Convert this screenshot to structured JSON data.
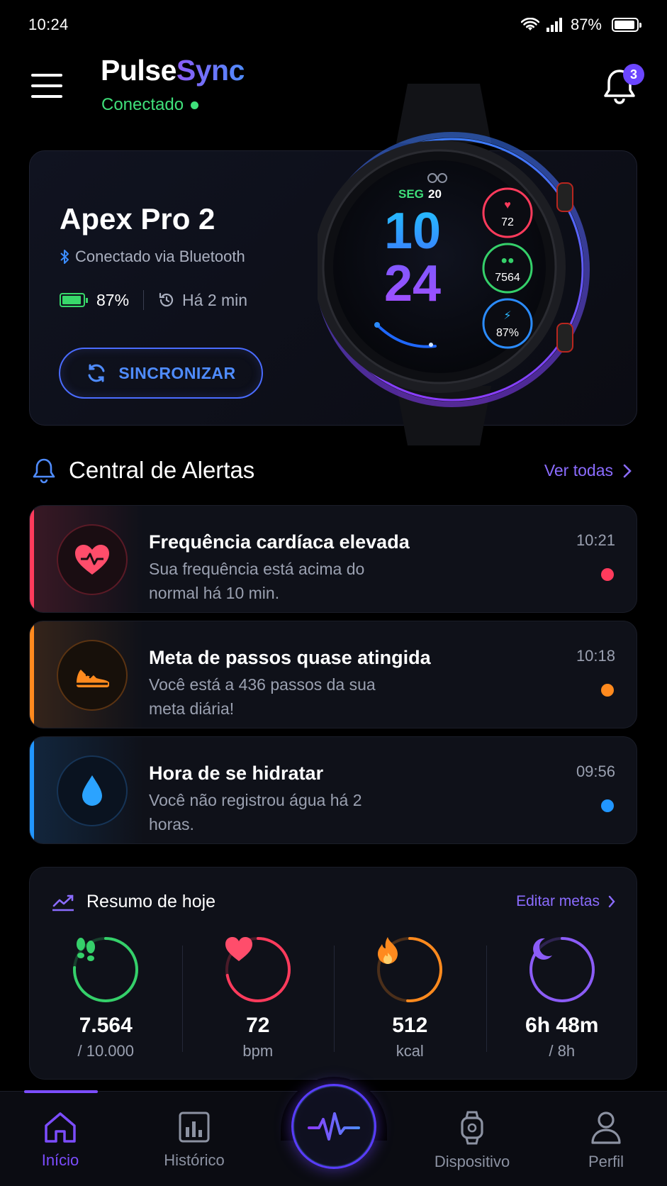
{
  "status_bar": {
    "time": "10:24",
    "battery": "87%"
  },
  "header": {
    "brand_part1": "Pulse",
    "brand_part2": "Sync",
    "connection_status": "Conectado",
    "notification_count": "3"
  },
  "device": {
    "name": "Apex Pro 2",
    "connection": "Conectado via Bluetooth",
    "battery": "87%",
    "last_sync": "Há 2 min",
    "sync_button": "SINCRONIZAR",
    "watch_face": {
      "day": "SEG",
      "date": "20",
      "hour": "10",
      "minute": "24",
      "heart_rate": "72",
      "steps": "7564",
      "battery": "87%",
      "progress": 0.55
    }
  },
  "alerts": {
    "title": "Central de Alertas",
    "see_all": "Ver todas",
    "items": [
      {
        "title": "Frequência cardíaca elevada",
        "desc": "Sua frequência está acima do normal há 10 min.",
        "time": "10:21",
        "color": "#ff3b5c",
        "icon": "heart-pulse-icon"
      },
      {
        "title": "Meta de passos quase atingida",
        "desc": "Você está a 436 passos da sua meta diária!",
        "time": "10:18",
        "color": "#ff8a1e",
        "icon": "sneaker-icon"
      },
      {
        "title": "Hora de se hidratar",
        "desc": "Você não registrou água há 2 horas.",
        "time": "09:56",
        "color": "#2196ff",
        "icon": "water-drop-icon"
      }
    ]
  },
  "summary": {
    "title": "Resumo de hoje",
    "edit_goals": "Editar metas",
    "metrics": [
      {
        "value": "7.564",
        "sub": "/ 10.000",
        "color": "#35d06a",
        "progress": 0.76,
        "icon": "footsteps-icon"
      },
      {
        "value": "72",
        "sub": "bpm",
        "color": "#ff3b5c",
        "progress": 0.72,
        "icon": "heart-icon"
      },
      {
        "value": "512",
        "sub": "kcal",
        "color": "#ff8a1e",
        "progress": 0.51,
        "icon": "flame-icon"
      },
      {
        "value": "6h 48m",
        "sub": "/ 8h",
        "color": "#8b5cf6",
        "progress": 0.85,
        "icon": "moon-icon"
      }
    ]
  },
  "nav": {
    "items": [
      {
        "label": "Início",
        "icon": "home-icon",
        "active": true
      },
      {
        "label": "Histórico",
        "icon": "bar-chart-icon",
        "active": false
      },
      {
        "label": "Dispositivo",
        "icon": "watch-icon",
        "active": false
      },
      {
        "label": "Perfil",
        "icon": "user-icon",
        "active": false
      }
    ],
    "center_icon": "pulse-icon"
  }
}
